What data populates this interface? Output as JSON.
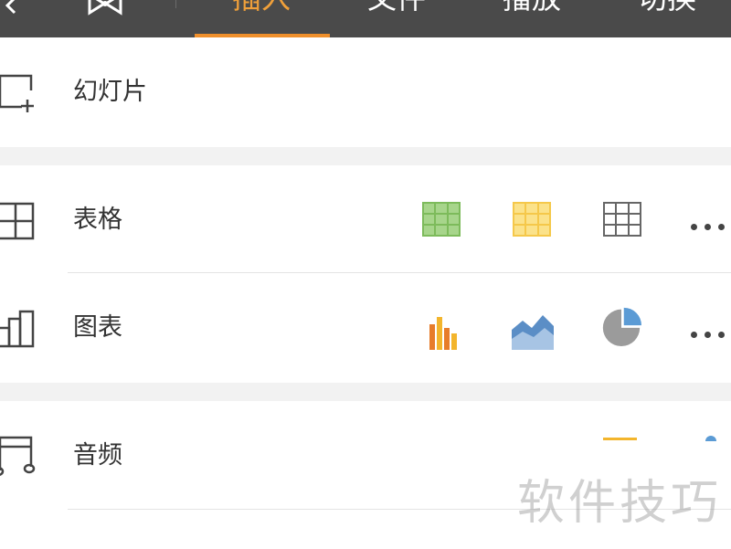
{
  "toolbar": {
    "tabs": [
      {
        "label": "插入",
        "active": true
      },
      {
        "label": "文件",
        "active": false
      },
      {
        "label": "播放",
        "active": false
      },
      {
        "label": "切换",
        "active": false
      }
    ],
    "accent_color": "#ef8f2b",
    "background_color": "#4a4a4a"
  },
  "menu": {
    "slide": {
      "label": "幻灯片",
      "icon": "add-slide-icon"
    },
    "table": {
      "label": "表格",
      "icon": "table-icon",
      "options": [
        {
          "icon": "green-table-style-icon",
          "color": "#7dbb5b"
        },
        {
          "icon": "yellow-table-style-icon",
          "color": "#f5c84a"
        },
        {
          "icon": "plain-table-style-icon",
          "color": "#666666"
        }
      ],
      "more_icon": "more-icon"
    },
    "chart": {
      "label": "图表",
      "icon": "chart-icon",
      "options": [
        {
          "icon": "bar-chart-icon",
          "colors": [
            "#e77c2a",
            "#f3b52c"
          ]
        },
        {
          "icon": "area-chart-icon",
          "colors": [
            "#5b8ec6",
            "#a7c4e4"
          ]
        },
        {
          "icon": "pie-chart-icon",
          "colors": [
            "#9b9b9b",
            "#5b9bd5"
          ]
        }
      ],
      "more_icon": "more-icon"
    },
    "audio": {
      "label": "音频",
      "icon": "music-note-icon"
    }
  },
  "watermark": "软件技巧"
}
